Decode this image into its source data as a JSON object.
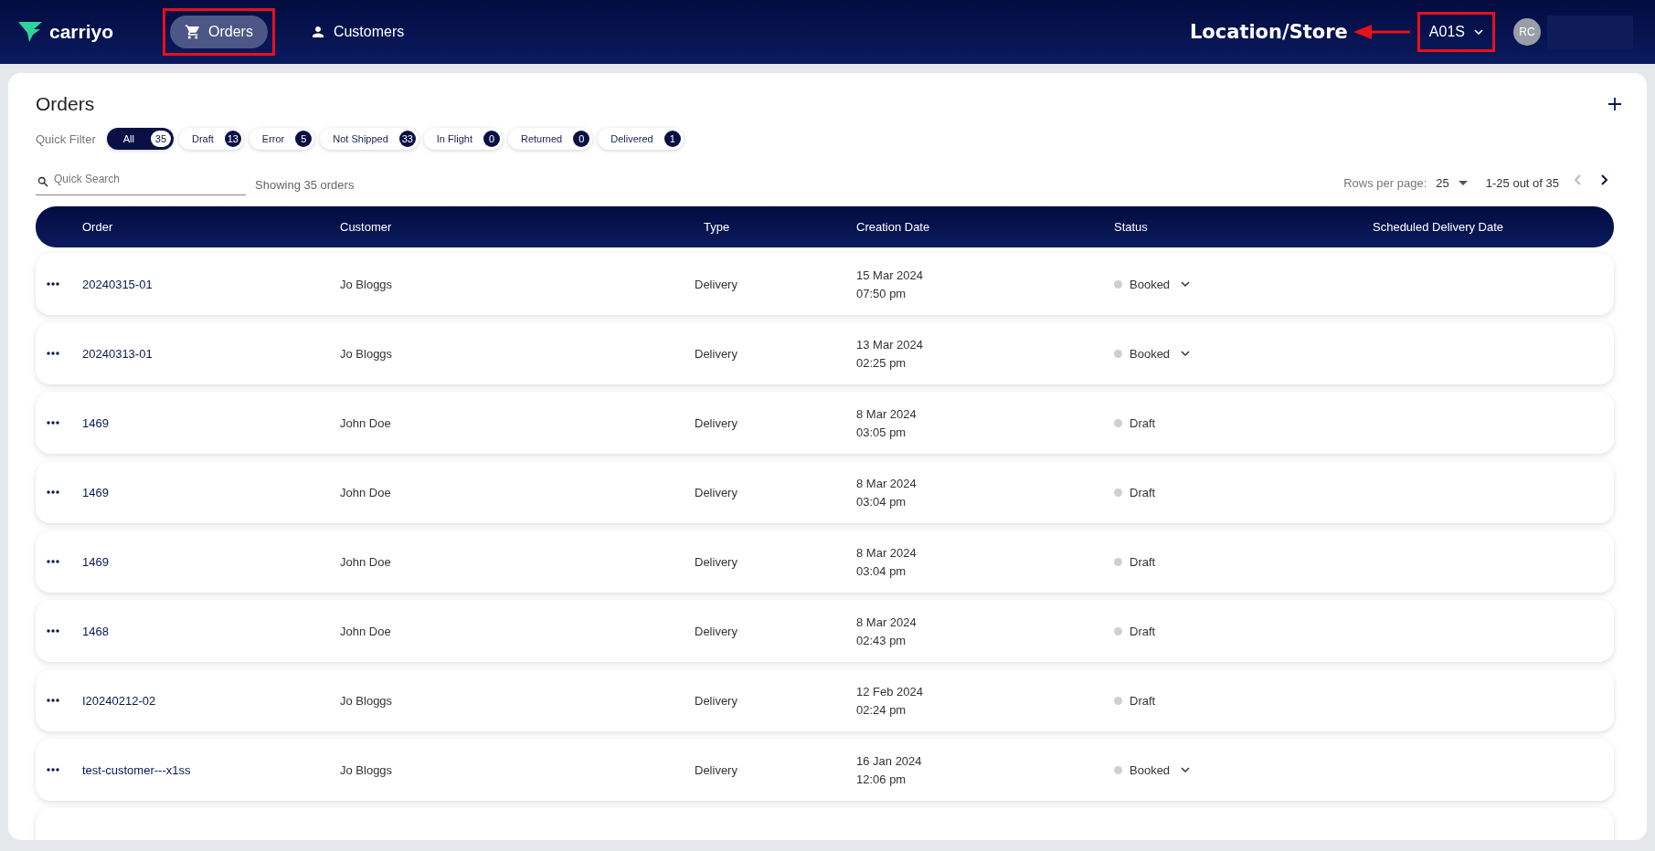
{
  "nav": {
    "brand": "carriyo",
    "items": [
      {
        "label": "Orders",
        "kind": "cart",
        "selected": true,
        "highlighted": true
      },
      {
        "label": "Customers",
        "kind": "person",
        "selected": false,
        "highlighted": false
      }
    ]
  },
  "annotation": {
    "label": "Location/Store"
  },
  "store_select": {
    "value": "A01S",
    "highlighted": true
  },
  "user": {
    "initials": "RC"
  },
  "page": {
    "title": "Orders"
  },
  "quick_filter": {
    "label": "Quick Filter",
    "chips": [
      {
        "label": "All",
        "count": "35",
        "selected": true
      },
      {
        "label": "Draft",
        "count": "13",
        "selected": false
      },
      {
        "label": "Error",
        "count": "5",
        "selected": false
      },
      {
        "label": "Not Shipped",
        "count": "33",
        "selected": false
      },
      {
        "label": "In Flight",
        "count": "0",
        "selected": false
      },
      {
        "label": "Returned",
        "count": "0",
        "selected": false
      },
      {
        "label": "Delivered",
        "count": "1",
        "selected": false
      }
    ]
  },
  "search": {
    "placeholder": "Quick Search"
  },
  "summary": "Showing 35 orders",
  "pagination": {
    "rows_label": "Rows per page:",
    "rows_value": "25",
    "range": "1-25 out of 35",
    "prev_disabled": true,
    "next_disabled": false
  },
  "table": {
    "columns": [
      "Order",
      "Customer",
      "Type",
      "Creation Date",
      "Status",
      "Scheduled Delivery Date"
    ],
    "rows": [
      {
        "order": "20240315-01",
        "customer": "Jo Bloggs",
        "type": "Delivery",
        "date": "15 Mar 2024",
        "time": "07:50 pm",
        "status": "Booked",
        "has_menu": true
      },
      {
        "order": "20240313-01",
        "customer": "Jo Bloggs",
        "type": "Delivery",
        "date": "13 Mar 2024",
        "time": "02:25 pm",
        "status": "Booked",
        "has_menu": true
      },
      {
        "order": "1469",
        "customer": "John Doe",
        "type": "Delivery",
        "date": "8 Mar 2024",
        "time": "03:05 pm",
        "status": "Draft",
        "has_menu": false
      },
      {
        "order": "1469",
        "customer": "John Doe",
        "type": "Delivery",
        "date": "8 Mar 2024",
        "time": "03:04 pm",
        "status": "Draft",
        "has_menu": false
      },
      {
        "order": "1469",
        "customer": "John Doe",
        "type": "Delivery",
        "date": "8 Mar 2024",
        "time": "03:04 pm",
        "status": "Draft",
        "has_menu": false
      },
      {
        "order": "1468",
        "customer": "John Doe",
        "type": "Delivery",
        "date": "8 Mar 2024",
        "time": "02:43 pm",
        "status": "Draft",
        "has_menu": false
      },
      {
        "order": "I20240212-02",
        "customer": "Jo Bloggs",
        "type": "Delivery",
        "date": "12 Feb 2024",
        "time": "02:24 pm",
        "status": "Draft",
        "has_menu": false
      },
      {
        "order": "test-customer---x1ss",
        "customer": "Jo Bloggs",
        "type": "Delivery",
        "date": "16 Jan 2024",
        "time": "12:06 pm",
        "status": "Booked",
        "has_menu": true
      }
    ]
  }
}
